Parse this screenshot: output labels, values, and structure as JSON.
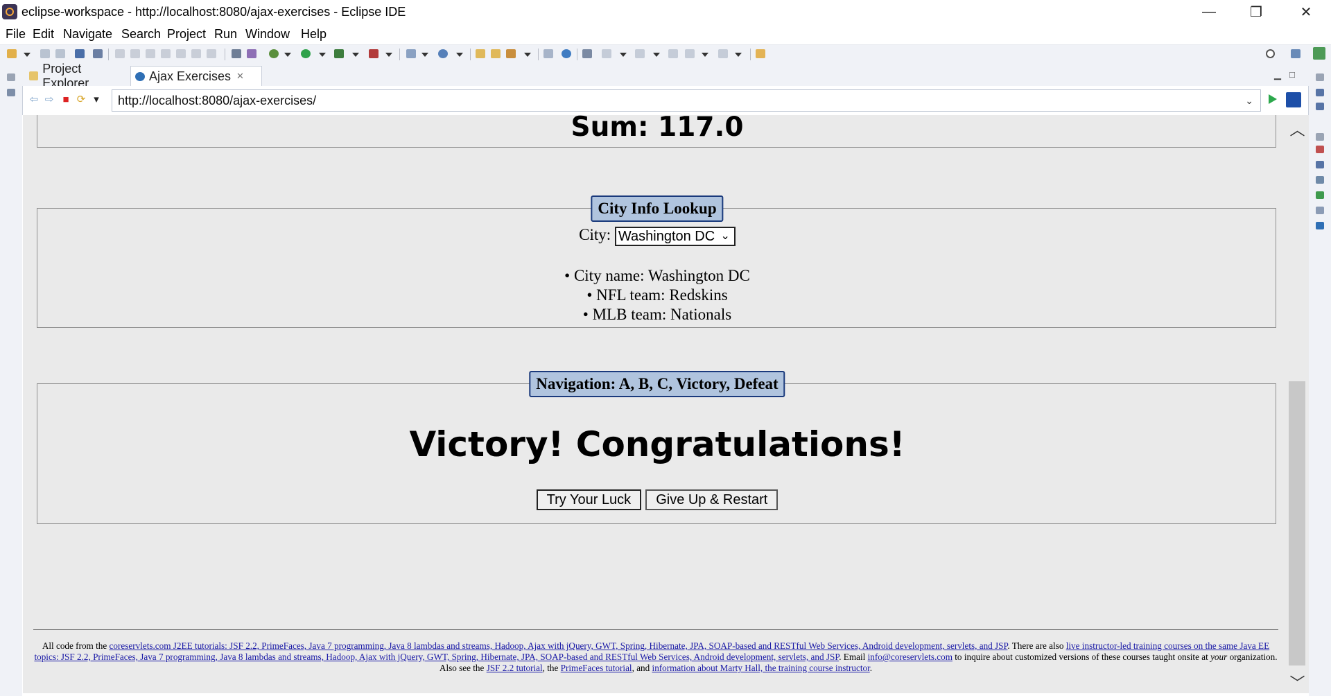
{
  "window": {
    "title": "eclipse-workspace - http://localhost:8080/ajax-exercises - Eclipse IDE",
    "minimize": "—",
    "restore": "❐",
    "close": "✕"
  },
  "menu": [
    "File",
    "Edit",
    "Navigate",
    "Search",
    "Project",
    "Run",
    "Window",
    "Help"
  ],
  "tabs": {
    "project_explorer": "Project Explorer",
    "ajax_exercises": "Ajax Exercises",
    "close_glyph": "✕"
  },
  "browser": {
    "url": "http://localhost:8080/ajax-exercises/"
  },
  "page": {
    "sum_text": "Sum: 117.0",
    "city_panel": {
      "legend": "City Info Lookup",
      "label": "City:",
      "selected_city": "Washington DC",
      "items": [
        "•   City name: Washington DC",
        "•   NFL team: Redskins",
        "•   MLB team: Nationals"
      ]
    },
    "nav_panel": {
      "legend": "Navigation: A, B, C, Victory, Defeat",
      "message": "Victory! Congratulations!",
      "try_button": "Try Your Luck",
      "restart_button": "Give Up & Restart"
    },
    "footer": {
      "t1": "All code from the ",
      "l1": "coreservlets.com J2EE tutorials: JSF 2.2, PrimeFaces, Java 7 programming, Java 8 lambdas and streams, Hadoop, Ajax with jQuery, GWT, Spring, Hibernate, JPA, SOAP-based and RESTful Web Services, Android development, servlets, and JSP",
      "t2": ". There are also ",
      "l2": "live instructor-led training courses on the same Java EE topics: JSF 2.2, PrimeFaces, Java 7 programming, Java 8 lambdas and streams, Hadoop, Ajax with jQuery, GWT, Spring, Hibernate, JPA, SOAP-based and RESTful Web Services, Android development, servlets, and JSP",
      "t3": ". Email ",
      "l3": "info@coreservlets.com",
      "t4": " to inquire about customized versions of these courses taught onsite at ",
      "t5": "your",
      "t6": " organization. Also see the ",
      "l4": "JSF 2.2 tutorial",
      "t7": ", the ",
      "l5": "PrimeFaces tutorial",
      "t8": ", and ",
      "l6": "information about Marty Hall, the training course instructor",
      "t9": "."
    }
  }
}
